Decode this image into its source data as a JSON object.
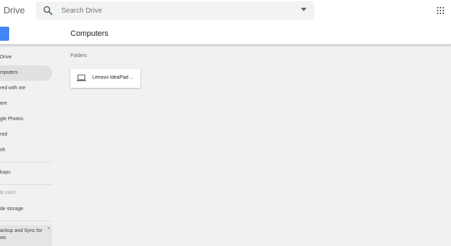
{
  "header": {
    "app_name": "Drive",
    "search_placeholder": "Search Drive"
  },
  "subheader": {
    "page_title": "Computers"
  },
  "sidebar": {
    "items": [
      {
        "label": "Drive",
        "active": false
      },
      {
        "label": "mputers",
        "active": true
      },
      {
        "label": "red with me",
        "active": false
      },
      {
        "label": "ent",
        "active": false
      },
      {
        "label": "gle Photos",
        "active": false
      },
      {
        "label": "red",
        "active": false
      },
      {
        "label": "sh",
        "active": false
      }
    ],
    "backups_label": "kups",
    "storage_used": "B used",
    "upgrade_label": "de storage",
    "promo_line1": "ackup and Sync for",
    "promo_line2": "ws",
    "promo_close": "×"
  },
  "main": {
    "section_label": "Folders",
    "folders": [
      {
        "name": "Lenovo IdeaPad ..."
      }
    ]
  },
  "colors": {
    "accent": "#4285f4",
    "background": "#f1f1f1",
    "active_nav": "#e0e0e0"
  },
  "icons": {
    "search": "search-icon",
    "options": "search-options-icon",
    "apps": "apps-icon",
    "folder": "laptop-icon"
  }
}
